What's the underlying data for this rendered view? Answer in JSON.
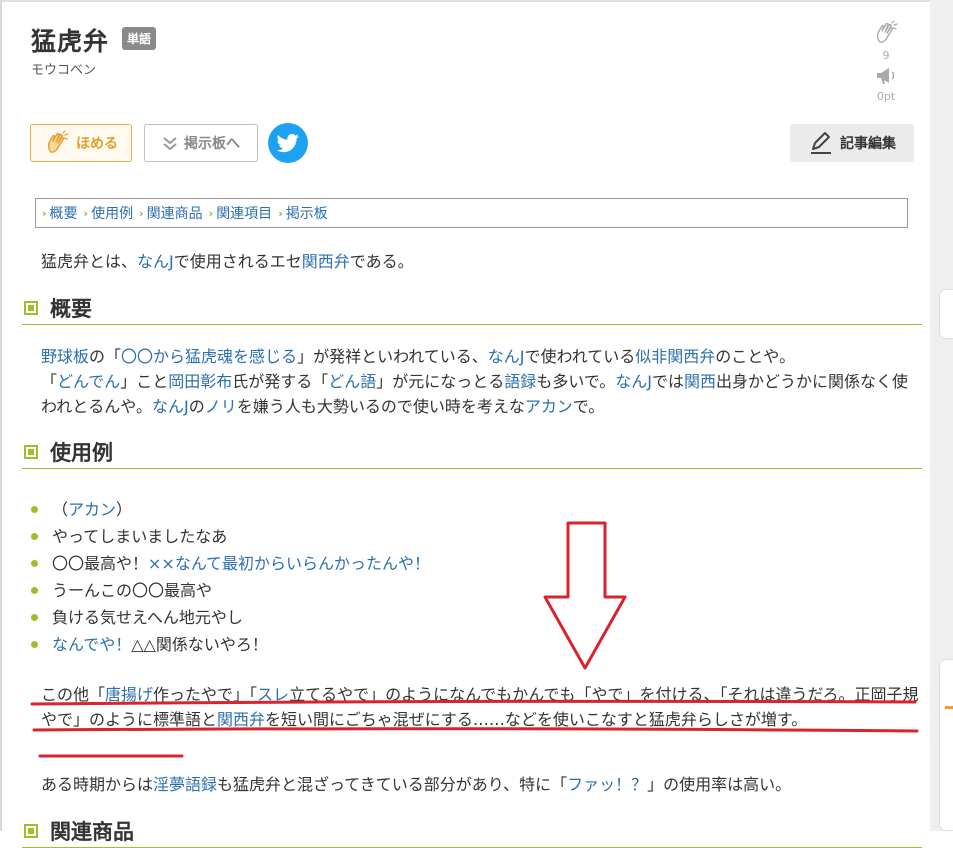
{
  "header": {
    "title": "猛虎弁",
    "badge": "単語",
    "reading": "モウコベン",
    "homeru_count": "9",
    "points": "0pt"
  },
  "toolbar": {
    "homeru_label": "ほめる",
    "bbs_label": "掲示板へ",
    "edit_label": "記事編集"
  },
  "toc": [
    "概要",
    "使用例",
    "関連商品",
    "関連項目",
    "掲示板"
  ],
  "intro": {
    "t1": "猛虎弁とは、",
    "l1": "なんJ",
    "t2": "で使用されるエセ",
    "l2": "関西弁",
    "t3": "である。"
  },
  "sections": {
    "overview": "概要",
    "usage": "使用例",
    "related_products": "関連商品"
  },
  "overview": {
    "l1": "野球板",
    "t1": "の「",
    "l2": "〇〇から",
    "l3": "猛虎魂を感じる",
    "t2": "」が発祥といわれている、",
    "l4": "なんJ",
    "t3": "で使われている",
    "l5": "似非関西弁",
    "t4": "のことや。",
    "t5": "「",
    "l6": "どんでん",
    "t6": "」こと",
    "l7": "岡田彰布",
    "t7": "氏が発する「",
    "l8": "どん語",
    "t8": "」が元になっとる",
    "l9": "語録",
    "t9": "も多いで。",
    "l10": "なんJ",
    "t10": "では",
    "l11": "関西",
    "t11": "出身かどうかに関係なく使われとるんや。",
    "l12": "なんJ",
    "t12": "の",
    "l13": "ノリ",
    "t13": "を嫌う人も大勢いるので使い時を考えな",
    "l14": "アカン",
    "t14": "で。"
  },
  "examples": {
    "e1a": "（",
    "e1l": "アカン",
    "e1b": "）",
    "e2": "やってしまいましたなあ",
    "e3a": "〇〇最高や！",
    "e3l": "××なんて最初からいらんかったんや！",
    "e4": "うーんこの〇〇最高や",
    "e5": "負ける気せえへん地元やし",
    "e6l": "なんでや！",
    "e6b": "△△関係ないやろ！"
  },
  "note1": {
    "t1": "この他「",
    "l1": "唐揚げ",
    "t2": "作ったやで」「",
    "l2": "スレ",
    "t3": "立てるやで」のようになんでもかんでも「やで」を付ける、「それは違うだろ。正岡子規やで」のように標準語と",
    "l3": "関西弁",
    "t4": "を短い間にごちゃ混ぜにする……などを使いこなすと猛虎弁らしさが増す。"
  },
  "note2": {
    "t1": "ある時期からは",
    "l1": "淫夢語録",
    "t2": "も猛虎弁と混ざってきている部分があり、特に「",
    "l2": "ファッ！？",
    "t3": "」の使用率は高い。"
  },
  "colors": {
    "link": "#2a6fb0",
    "accent_green": "#9cbf2a",
    "annotation_red": "#d9232e",
    "homeru_orange": "#e0a030",
    "twitter_blue": "#1da1f2"
  }
}
